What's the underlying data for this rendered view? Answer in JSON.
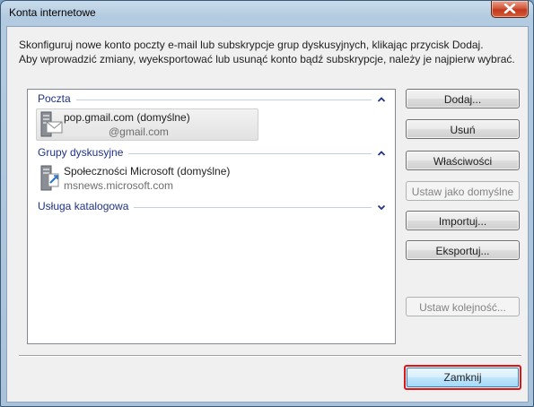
{
  "window": {
    "title": "Konta internetowe",
    "close_icon": "close-icon"
  },
  "description": {
    "line1": "Skonfiguruj nowe konto poczty e-mail lub subskrypcje grup dyskusyjnych, klikając przycisk Dodaj.",
    "line2": "Aby wprowadzić zmiany, wyeksportować lub usunąć konto bądź subskrypcje, należy je najpierw wybrać."
  },
  "accounts": {
    "groups": [
      {
        "label": "Poczta",
        "chevron": "up",
        "items": [
          {
            "name": "pop.gmail.com (domyślne)",
            "sub": "@gmail.com",
            "icon": "mail-server-icon",
            "selected": true
          }
        ]
      },
      {
        "label": "Grupy dyskusyjne",
        "chevron": "up",
        "items": [
          {
            "name": "Społeczności Microsoft (domyślne)",
            "sub": "msnews.microsoft.com",
            "icon": "news-server-icon",
            "selected": false
          }
        ]
      },
      {
        "label": "Usługa katalogowa",
        "chevron": "down",
        "items": []
      }
    ]
  },
  "buttons": {
    "add": "Dodaj...",
    "remove": "Usuń",
    "properties": "Właściwości",
    "set_default": "Ustaw jako domyślne",
    "import": "Importuj...",
    "export": "Eksportuj...",
    "set_order": "Ustaw kolejność...",
    "close": "Zamknij"
  },
  "colors": {
    "group_label": "#1e3287",
    "highlight_border": "#d81818"
  }
}
